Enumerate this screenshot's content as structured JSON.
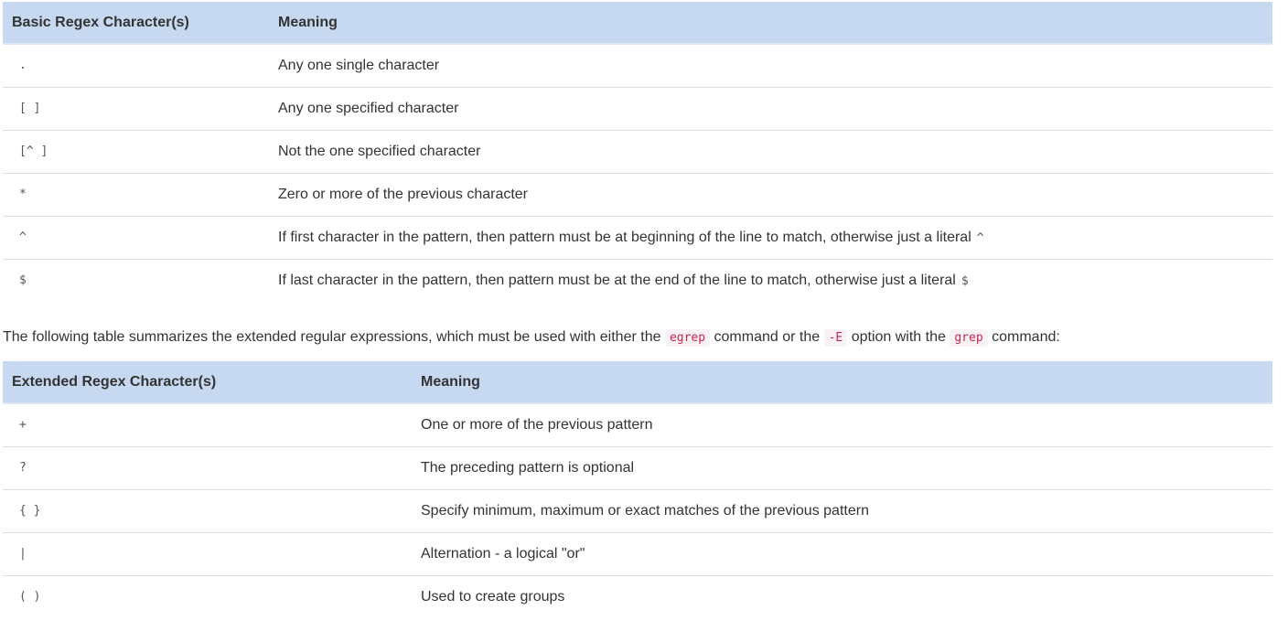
{
  "basic_table": {
    "headers": [
      "Basic Regex Character(s)",
      "Meaning"
    ],
    "rows": [
      {
        "symbol": ".",
        "meaning": "Any one single character",
        "literal": ""
      },
      {
        "symbol": "[ ]",
        "meaning": "Any one specified character",
        "literal": ""
      },
      {
        "symbol": "[^ ]",
        "meaning": "Not the one specified character",
        "literal": ""
      },
      {
        "symbol": "*",
        "meaning": "Zero or more of the previous character",
        "literal": ""
      },
      {
        "symbol": "^",
        "meaning": "If first character in the pattern, then pattern must be at beginning of the line to match, otherwise just a literal",
        "literal": "^"
      },
      {
        "symbol": "$",
        "meaning": "If last character in the pattern, then pattern must be at the end of the line to match, otherwise just a literal",
        "literal": "$"
      }
    ]
  },
  "paragraph": {
    "part1": "The following table summarizes the extended regular expressions, which must be used with either the",
    "code1": "egrep",
    "part2": "command or the",
    "code2": "-E",
    "part3": "option with the",
    "code3": "grep",
    "part4": "command:"
  },
  "extended_table": {
    "headers": [
      "Extended Regex Character(s)",
      "Meaning"
    ],
    "rows": [
      {
        "symbol": "+",
        "meaning": "One or more of the previous pattern"
      },
      {
        "symbol": "?",
        "meaning": "The preceding pattern is optional"
      },
      {
        "symbol": "{ }",
        "meaning": "Specify minimum, maximum or exact matches of the previous pattern"
      },
      {
        "symbol": "|",
        "meaning": "Alternation - a logical \"or\""
      },
      {
        "symbol": "( )",
        "meaning": "Used to create groups"
      }
    ]
  }
}
